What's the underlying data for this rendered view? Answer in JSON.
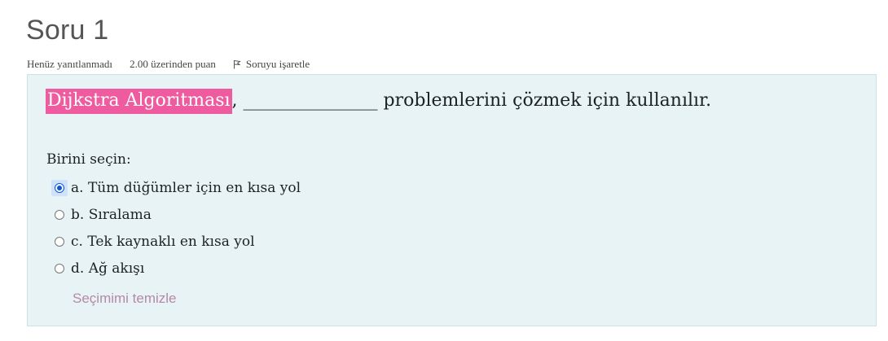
{
  "question": {
    "title": "Soru 1",
    "status": "Henüz yanıtlanmadı",
    "points": "2.00 üzerinden puan",
    "flag_label": "Soruyu işaretle"
  },
  "content": {
    "highlighted_text": "Dijkstra Algoritması",
    "text_rest": ", _______________ problemlerini çözmek için kullanılır.",
    "prompt": "Birini seçin:",
    "answers": [
      {
        "label": "a. Tüm düğümler için en kısa yol",
        "selected": true
      },
      {
        "label": "b. Sıralama",
        "selected": false
      },
      {
        "label": "c. Tek kaynaklı en kısa yol",
        "selected": false
      },
      {
        "label": "d. Ağ akışı",
        "selected": false
      }
    ],
    "clear_label": "Seçimimi temizle"
  },
  "colors": {
    "highlight_bg": "#ee5b9f",
    "content_bg": "#e7f3f5",
    "clear_link": "#b58aa6"
  },
  "icons": {
    "flag": "flag-icon"
  }
}
